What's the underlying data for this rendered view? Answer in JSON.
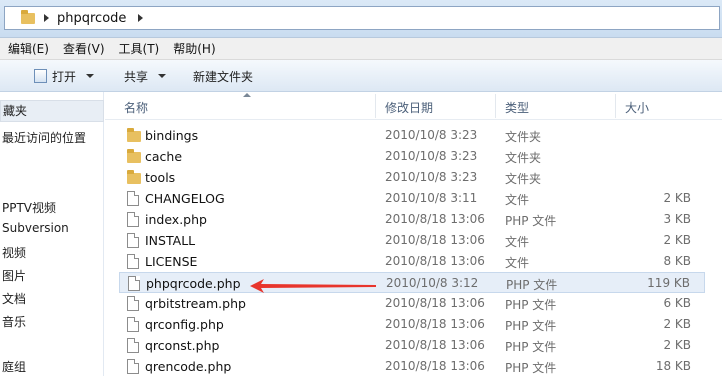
{
  "address_bar": {
    "folder_icon": "folder-icon",
    "path": "phpqrcode"
  },
  "menu": [
    {
      "label": "编辑(E)"
    },
    {
      "label": "查看(V)"
    },
    {
      "label": "工具(T)"
    },
    {
      "label": "帮助(H)"
    }
  ],
  "toolbar": {
    "open_label": "打开",
    "share_label": "共享",
    "new_folder_label": "新建文件夹"
  },
  "nav": {
    "favorites_label": "藏夹",
    "items": [
      {
        "label": "最近访问的位置"
      },
      {
        "label": "PPTV视频"
      },
      {
        "label": "Subversion"
      },
      {
        "label": "视频"
      },
      {
        "label": "图片"
      },
      {
        "label": "文档"
      },
      {
        "label": "音乐"
      },
      {
        "label": "庭组"
      }
    ]
  },
  "columns": {
    "name": "名称",
    "date": "修改日期",
    "type": "类型",
    "size": "大小"
  },
  "files": [
    {
      "name": "bindings",
      "date": "2010/10/8 3:23",
      "type": "文件夹",
      "size": "",
      "icon": "folder-icon"
    },
    {
      "name": "cache",
      "date": "2010/10/8 3:23",
      "type": "文件夹",
      "size": "",
      "icon": "folder-icon"
    },
    {
      "name": "tools",
      "date": "2010/10/8 3:23",
      "type": "文件夹",
      "size": "",
      "icon": "folder-icon"
    },
    {
      "name": "CHANGELOG",
      "date": "2010/10/8 3:11",
      "type": "文件",
      "size": "2 KB",
      "icon": "file-icon"
    },
    {
      "name": "index.php",
      "date": "2010/8/18 13:06",
      "type": "PHP 文件",
      "size": "3 KB",
      "icon": "php-file-icon"
    },
    {
      "name": "INSTALL",
      "date": "2010/8/18 13:06",
      "type": "文件",
      "size": "2 KB",
      "icon": "file-icon"
    },
    {
      "name": "LICENSE",
      "date": "2010/8/18 13:06",
      "type": "文件",
      "size": "8 KB",
      "icon": "file-icon"
    },
    {
      "name": "phpqrcode.php",
      "date": "2010/10/8 3:12",
      "type": "PHP 文件",
      "size": "119 KB",
      "icon": "php-file-icon"
    },
    {
      "name": "qrbitstream.php",
      "date": "2010/8/18 13:06",
      "type": "PHP 文件",
      "size": "6 KB",
      "icon": "php-file-icon"
    },
    {
      "name": "qrconfig.php",
      "date": "2010/8/18 13:06",
      "type": "PHP 文件",
      "size": "2 KB",
      "icon": "php-file-icon"
    },
    {
      "name": "qrconst.php",
      "date": "2010/8/18 13:06",
      "type": "PHP 文件",
      "size": "2 KB",
      "icon": "php-file-icon"
    },
    {
      "name": "qrencode.php",
      "date": "2010/8/18 13:06",
      "type": "PHP 文件",
      "size": "18 KB",
      "icon": "php-file-icon"
    }
  ],
  "colors": {
    "annotation_arrow": "#e8352c",
    "selection": "#e6eef8"
  }
}
